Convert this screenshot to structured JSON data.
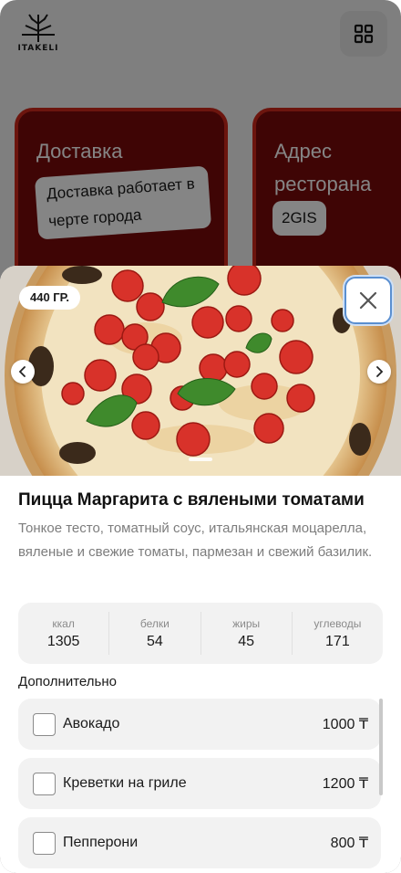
{
  "header": {
    "logo_text": "ITAKELI",
    "menu_icon": "grid-icon"
  },
  "cards": [
    {
      "title": "Доставка",
      "chip": "Доставка работает в черте города"
    },
    {
      "title": "Адрес ресторана",
      "chip": "2GIS"
    }
  ],
  "product": {
    "weight": "440 ГР.",
    "title": "Пицца Маргарита с вялеными томатами",
    "description": "Тонкое тесто, томатный соус, итальянская моцарелла, вяленые и свежие томаты, пармезан и свежий базилик.",
    "image_icon": "pizza-image"
  },
  "nutrition": [
    {
      "label": "ккал",
      "value": "1305"
    },
    {
      "label": "белки",
      "value": "54"
    },
    {
      "label": "жиры",
      "value": "45"
    },
    {
      "label": "углеводы",
      "value": "171"
    }
  ],
  "extras": {
    "title": "Дополнительно",
    "items": [
      {
        "name": "Авокадо",
        "price": "1000 ₸"
      },
      {
        "name": "Креветки на гриле",
        "price": "1200 ₸"
      },
      {
        "name": "Пепперони",
        "price": "800 ₸"
      }
    ]
  },
  "colors": {
    "card_bg": "#7a0a0a",
    "card_border": "#cf2a1c",
    "close_focus": "#5a8fd0"
  }
}
